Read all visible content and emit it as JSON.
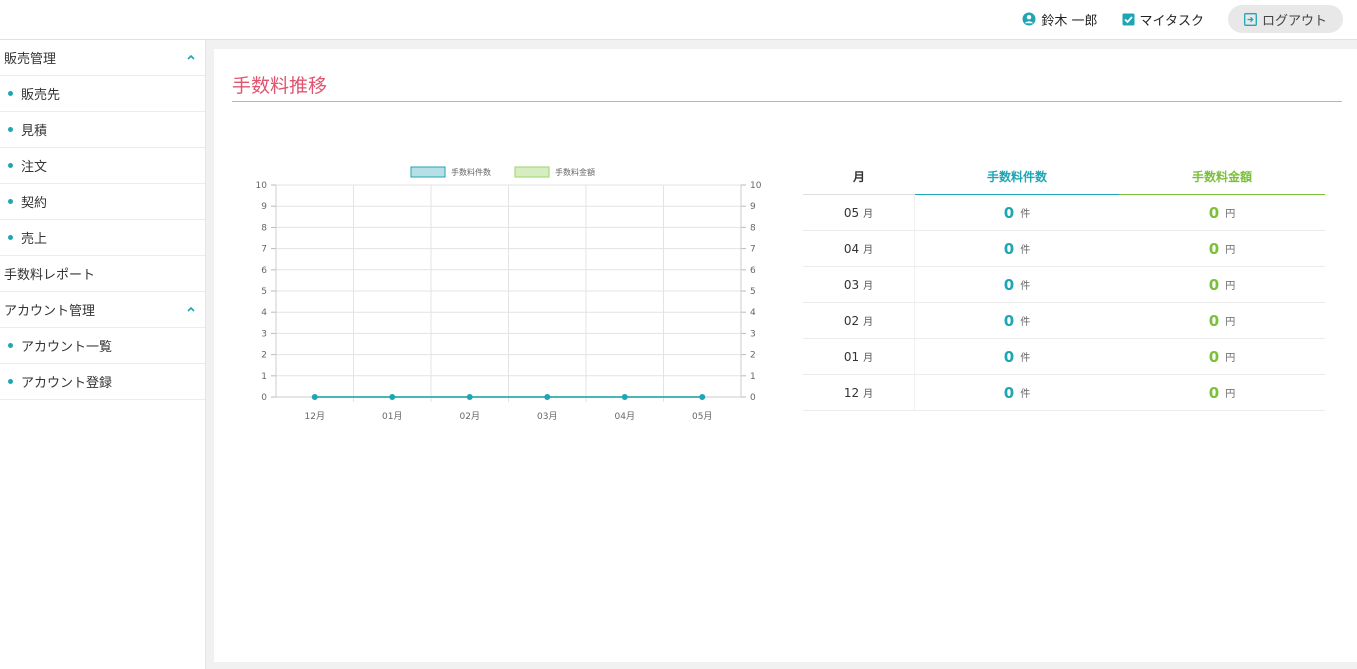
{
  "header": {
    "user_name": "鈴木 一郎",
    "my_task": "マイタスク",
    "logout": "ログアウト"
  },
  "sidebar": {
    "items": [
      {
        "label": "販売管理",
        "type": "section",
        "collapsible": true
      },
      {
        "label": "販売先",
        "type": "sub"
      },
      {
        "label": "見積",
        "type": "sub"
      },
      {
        "label": "注文",
        "type": "sub"
      },
      {
        "label": "契約",
        "type": "sub"
      },
      {
        "label": "売上",
        "type": "sub"
      },
      {
        "label": "手数料レポート",
        "type": "section",
        "collapsible": false
      },
      {
        "label": "アカウント管理",
        "type": "section",
        "collapsible": true
      },
      {
        "label": "アカウント一覧",
        "type": "sub"
      },
      {
        "label": "アカウント登録",
        "type": "sub"
      }
    ]
  },
  "main": {
    "title": "手数料推移"
  },
  "chart_data": {
    "type": "line",
    "categories": [
      "12月",
      "01月",
      "02月",
      "03月",
      "04月",
      "05月"
    ],
    "series": [
      {
        "name": "手数料件数",
        "values": [
          0,
          0,
          0,
          0,
          0,
          0
        ],
        "color": "#1fa6b5"
      },
      {
        "name": "手数料金額",
        "values": [
          0,
          0,
          0,
          0,
          0,
          0
        ],
        "color": "#9ed26b"
      }
    ],
    "ylim": [
      0,
      10
    ],
    "y2lim": [
      0,
      10
    ],
    "yticks": [
      "0",
      "1",
      "2",
      "3",
      "4",
      "5",
      "6",
      "7",
      "8",
      "9",
      "10"
    ],
    "grid": true,
    "legend": "top"
  },
  "table": {
    "headers": [
      "月",
      "手数料件数",
      "手数料金額"
    ],
    "month_unit": "月",
    "count_unit": "件",
    "amount_unit": "円",
    "rows": [
      {
        "month": "05",
        "count": "0",
        "amount": "0"
      },
      {
        "month": "04",
        "count": "0",
        "amount": "0"
      },
      {
        "month": "03",
        "count": "0",
        "amount": "0"
      },
      {
        "month": "02",
        "count": "0",
        "amount": "0"
      },
      {
        "month": "01",
        "count": "0",
        "amount": "0"
      },
      {
        "month": "12",
        "count": "0",
        "amount": "0"
      }
    ]
  },
  "colors": {
    "accent_teal": "#1fa6b5",
    "accent_green": "#7cbf3c",
    "title_pink": "#e05470"
  }
}
